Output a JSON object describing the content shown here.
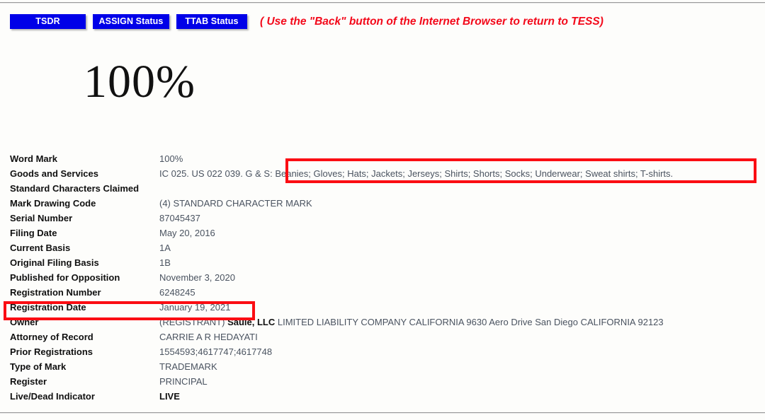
{
  "toolbar": {
    "buttons": [
      {
        "label": "TSDR",
        "name": "tsdr-button"
      },
      {
        "label": "ASSIGN Status",
        "name": "assign-status-button"
      },
      {
        "label": "TTAB Status",
        "name": "ttab-status-button"
      }
    ],
    "back_note": "( Use the \"Back\" button of the Internet Browser to return to TESS)"
  },
  "mark_drawing": {
    "text": "100%"
  },
  "record": {
    "rows": [
      {
        "label": "Word Mark",
        "value": "100%"
      },
      {
        "label": "Goods and Services",
        "value": "IC 025. US 022 039. G & S: Beanies; Gloves; Hats; Jackets; Jerseys; Shirts; Shorts; Socks; Underwear; Sweat shirts; T-shirts."
      },
      {
        "label": "Standard Characters Claimed",
        "value": ""
      },
      {
        "label": "Mark Drawing Code",
        "value": "(4) STANDARD CHARACTER MARK"
      },
      {
        "label": "Serial Number",
        "value": "87045437"
      },
      {
        "label": "Filing Date",
        "value": "May 20, 2016"
      },
      {
        "label": "Current Basis",
        "value": "1A"
      },
      {
        "label": "Original Filing Basis",
        "value": "1B"
      },
      {
        "label": "Published for Opposition",
        "value": "November 3, 2020"
      },
      {
        "label": "Registration Number",
        "value": "6248245"
      },
      {
        "label": "Registration Date",
        "value": "January 19, 2021"
      },
      {
        "label": "Owner",
        "value": "(REGISTRANT) Saule, LLC LIMITED LIABILITY COMPANY CALIFORNIA 9630 Aero Drive San Diego CALIFORNIA 92123"
      },
      {
        "label": "Attorney of Record",
        "value": "CARRIE A R HEDAYATI"
      },
      {
        "label": "Prior Registrations",
        "value": "1554593;4617747;4617748"
      },
      {
        "label": "Type of Mark",
        "value": "TRADEMARK"
      },
      {
        "label": "Register",
        "value": "PRINCIPAL"
      },
      {
        "label": "Live/Dead Indicator",
        "value": "LIVE"
      }
    ],
    "owner_row": {
      "prefix": "(REGISTRANT) ",
      "name": "Saule, LLC",
      "suffix": " LIMITED LIABILITY COMPANY CALIFORNIA 9630 Aero Drive San Diego CALIFORNIA 92123"
    }
  },
  "annotations": [
    {
      "name": "goods-and-services-highlight",
      "color": "#fb0d13"
    },
    {
      "name": "registration-date-highlight",
      "color": "#fb0d13"
    }
  ]
}
